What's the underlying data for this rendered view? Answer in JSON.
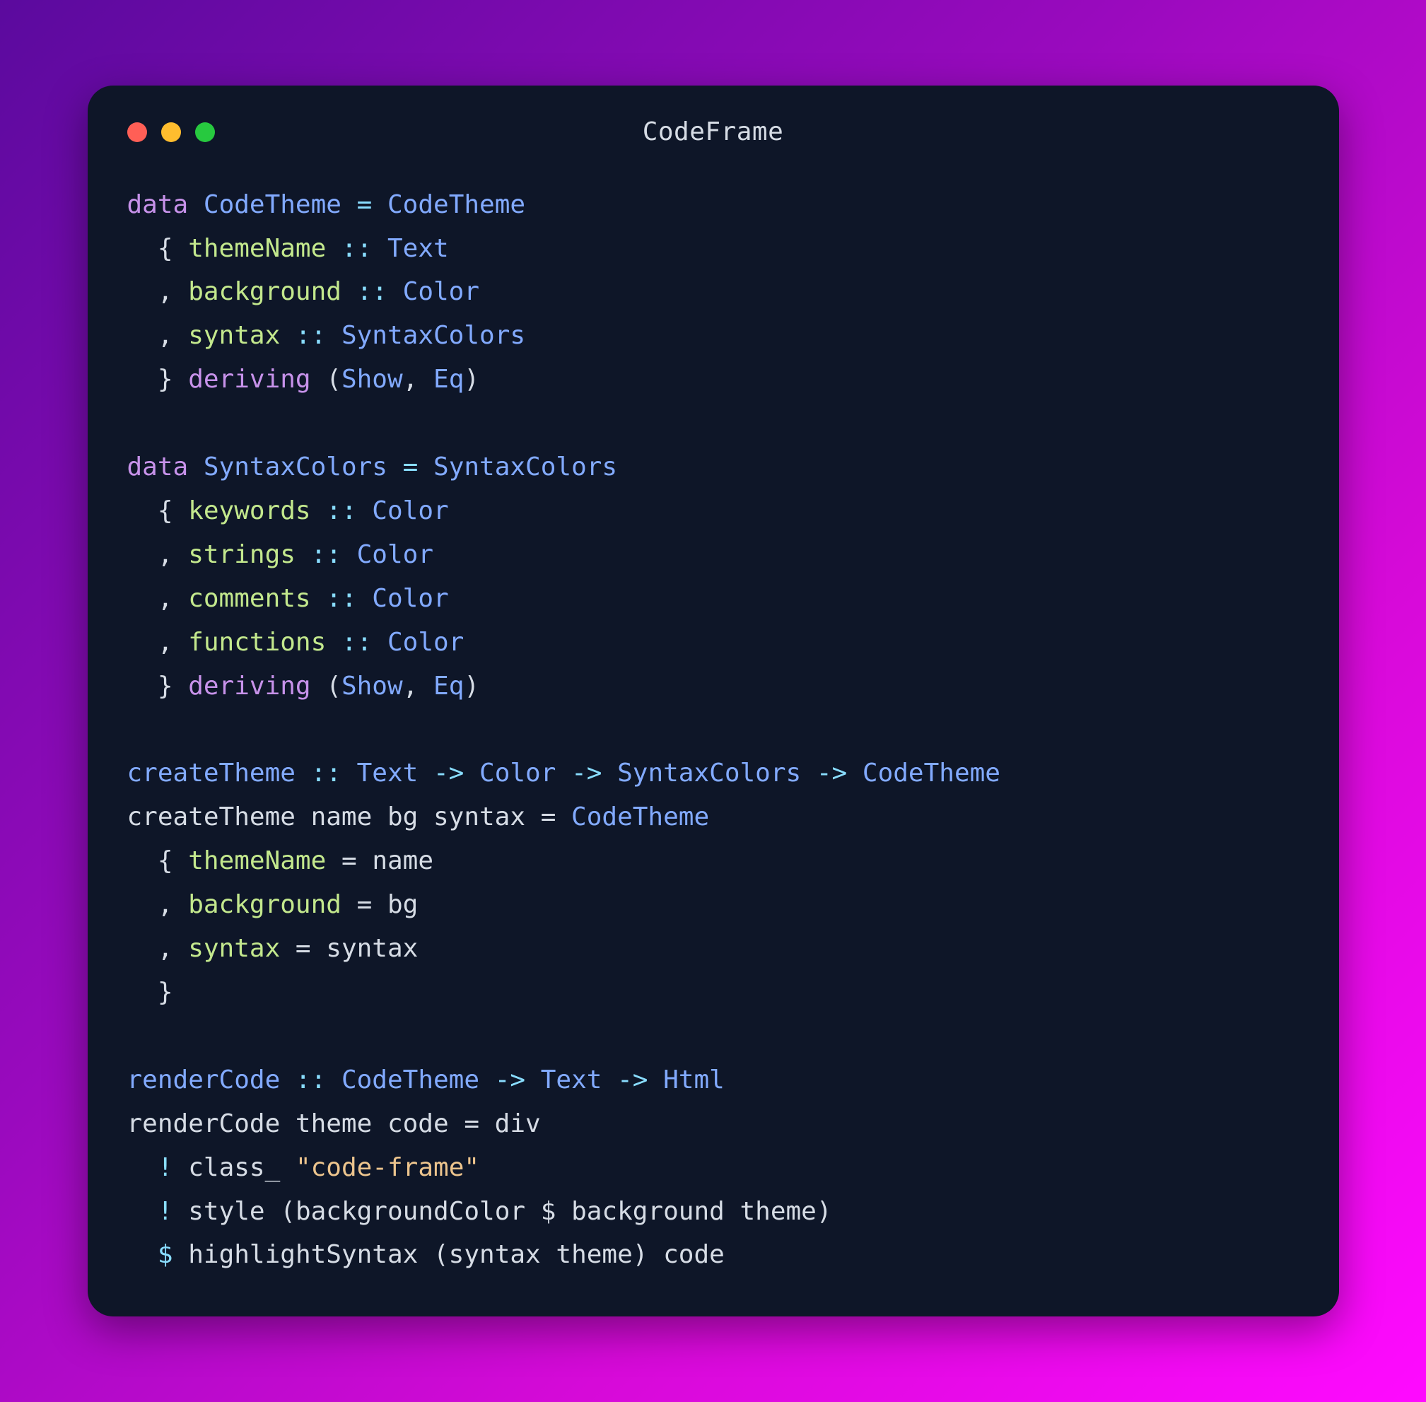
{
  "title": "CodeFrame",
  "code": {
    "l1": {
      "kw1": "data",
      "type1": "CodeTheme",
      "op1": " = ",
      "type2": "CodeTheme"
    },
    "l2": {
      "brace": "  { ",
      "field": "themeName",
      "op": " :: ",
      "type": "Text"
    },
    "l3": {
      "comma": "  , ",
      "field": "background",
      "op": " :: ",
      "type": "Color"
    },
    "l4": {
      "comma": "  , ",
      "field": "syntax",
      "op": " :: ",
      "type": "SyntaxColors"
    },
    "l5": {
      "brace": "  } ",
      "kw": "deriving",
      "paren1": " (",
      "type1": "Show",
      "comma": ", ",
      "type2": "Eq",
      "paren2": ")"
    },
    "l6": "",
    "l7": {
      "kw1": "data",
      "type1": "SyntaxColors",
      "op1": " = ",
      "type2": "SyntaxColors"
    },
    "l8": {
      "brace": "  { ",
      "field": "keywords",
      "op": " :: ",
      "type": "Color"
    },
    "l9": {
      "comma": "  , ",
      "field": "strings",
      "op": " :: ",
      "type": "Color"
    },
    "l10": {
      "comma": "  , ",
      "field": "comments",
      "op": " :: ",
      "type": "Color"
    },
    "l11": {
      "comma": "  , ",
      "field": "functions",
      "op": " :: ",
      "type": "Color"
    },
    "l12": {
      "brace": "  } ",
      "kw": "deriving",
      "paren1": " (",
      "type1": "Show",
      "comma": ", ",
      "type2": "Eq",
      "paren2": ")"
    },
    "l13": "",
    "l14": {
      "fn": "createTheme",
      "op1": " :: ",
      "type1": "Text",
      "arr1": " -> ",
      "type2": "Color",
      "arr2": " -> ",
      "type3": "SyntaxColors",
      "arr3": " -> ",
      "type4": "CodeTheme"
    },
    "l15": {
      "text1": "createTheme name bg syntax = ",
      "type": "CodeTheme"
    },
    "l16": {
      "brace": "  { ",
      "field": "themeName",
      "eq": " = ",
      "val": "name"
    },
    "l17": {
      "comma": "  , ",
      "field": "background",
      "eq": " = ",
      "val": "bg"
    },
    "l18": {
      "comma": "  , ",
      "field": "syntax",
      "eq": " = ",
      "val": "syntax"
    },
    "l19": {
      "brace": "  }"
    },
    "l20": "",
    "l21": {
      "fn": "renderCode",
      "op1": " :: ",
      "type1": "CodeTheme",
      "arr1": " -> ",
      "type2": "Text",
      "arr2": " -> ",
      "type3": "Html"
    },
    "l22": {
      "text": "renderCode theme code = div"
    },
    "l23": {
      "indent": "  ",
      "bang": "!",
      "text1": " class_ ",
      "q1": "\"",
      "str": "code-frame",
      "q2": "\""
    },
    "l24": {
      "indent": "  ",
      "bang": "!",
      "text": " style (backgroundColor $ background theme)"
    },
    "l25": {
      "indent": "  ",
      "dollar": "$",
      "text": " highlightSyntax (syntax theme) code"
    }
  }
}
